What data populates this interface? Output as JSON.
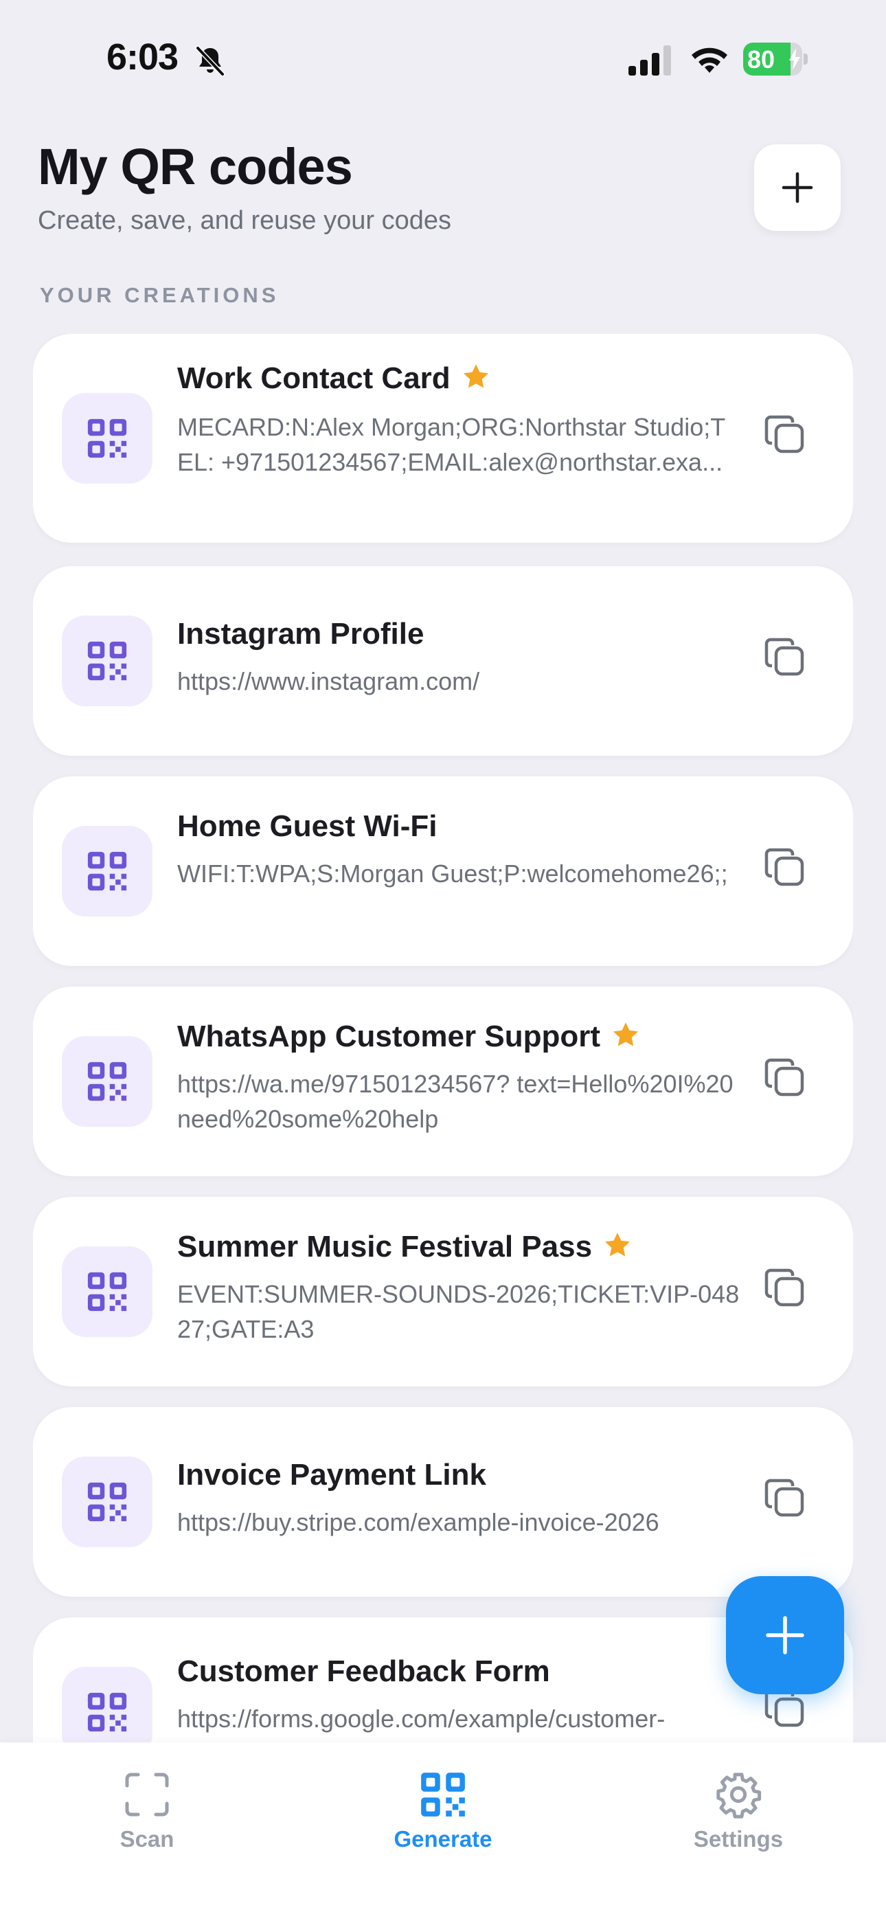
{
  "status_bar": {
    "time": "6:03",
    "battery_percent": "80",
    "battery_level": 0.8,
    "icons": [
      "bell-slash-icon",
      "signal-icon",
      "wifi-icon",
      "battery-icon"
    ]
  },
  "header": {
    "title": "My QR codes",
    "subtitle": "Create, save, and reuse your codes",
    "add_icon": "plus-icon"
  },
  "section": {
    "label": "YOUR CREATIONS"
  },
  "items": [
    {
      "title": "Work Contact Card",
      "favorite": true,
      "content": "MECARD:N:Alex Morgan;ORG:Northstar Studio;TEL: +971501234567;EMAIL:alex@northstar.exa..."
    },
    {
      "title": "Instagram Profile",
      "favorite": false,
      "content": "https://www.instagram.com/"
    },
    {
      "title": "Home Guest Wi-Fi",
      "favorite": false,
      "content": "WIFI:T:WPA;S:Morgan Guest;P:welcomehome26;;"
    },
    {
      "title": "WhatsApp Customer Support",
      "favorite": true,
      "content": "https://wa.me/971501234567? text=Hello%20I%20need%20some%20help"
    },
    {
      "title": "Summer Music Festival Pass",
      "favorite": true,
      "content": "EVENT:SUMMER-SOUNDS-2026;TICKET:VIP-04827;GATE:A3"
    },
    {
      "title": "Invoice Payment Link",
      "favorite": false,
      "content": "https://buy.stripe.com/example-invoice-2026"
    },
    {
      "title": "Customer Feedback Form",
      "favorite": false,
      "content": "https://forms.google.com/example/customer-"
    }
  ],
  "fab": {
    "icon": "plus-icon"
  },
  "tabs": [
    {
      "label": "Scan",
      "icon": "scan-frame-icon",
      "active": false
    },
    {
      "label": "Generate",
      "icon": "qr-code-icon",
      "active": true
    },
    {
      "label": "Settings",
      "icon": "gear-icon",
      "active": false
    }
  ],
  "colors": {
    "background": "#eeeef4",
    "card": "#ffffff",
    "accent": "#1e8ff2",
    "qr_purple": "#6e55d6",
    "qr_tile": "#f0ecfd",
    "star": "#f5a623",
    "battery_green": "#34c759"
  }
}
